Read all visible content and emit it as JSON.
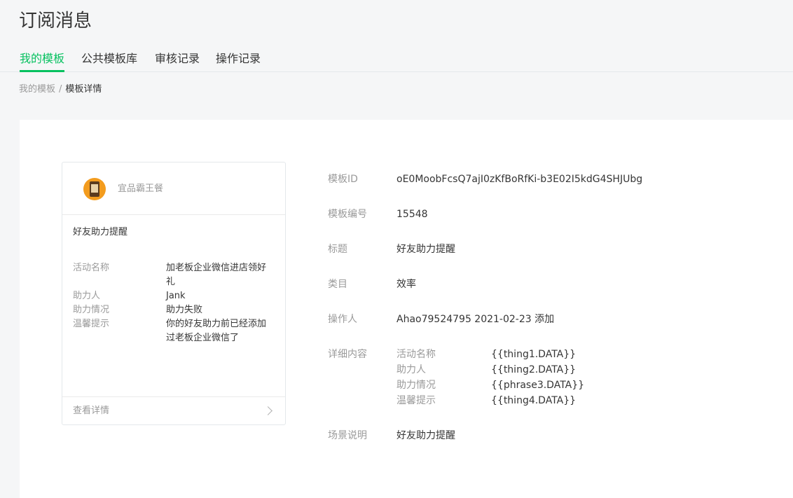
{
  "page_title": "订阅消息",
  "tabs": [
    {
      "label": "我的模板",
      "active": true
    },
    {
      "label": "公共模板库",
      "active": false
    },
    {
      "label": "审核记录",
      "active": false
    },
    {
      "label": "操作记录",
      "active": false
    }
  ],
  "breadcrumb": {
    "parent": "我的模板",
    "separator": "/",
    "current": "模板详情"
  },
  "preview": {
    "account_name": "宜品霸王餐",
    "title": "好友助力提醒",
    "fields": [
      {
        "key": "活动名称",
        "value": "加老板企业微信进店领好礼"
      },
      {
        "key": "助力人",
        "value": "Jank"
      },
      {
        "key": "助力情况",
        "value": "助力失败"
      },
      {
        "key": "温馨提示",
        "value": "你的好友助力前已经添加过老板企业微信了"
      }
    ],
    "footer_link": "查看详情"
  },
  "detail": {
    "template_id_label": "模板ID",
    "template_id": "oE0MoobFcsQ7ajI0zKfBoRfKi-b3E02I5kdG4SHJUbg",
    "template_number_label": "模板编号",
    "template_number": "15548",
    "title_label": "标题",
    "title": "好友助力提醒",
    "category_label": "类目",
    "category": "效率",
    "operator_label": "操作人",
    "operator": "Ahao79524795 2021-02-23 添加",
    "content_label": "详细内容",
    "content": [
      {
        "key": "活动名称",
        "value": "{{thing1.DATA}}"
      },
      {
        "key": "助力人",
        "value": "{{thing2.DATA}}"
      },
      {
        "key": "助力情况",
        "value": "{{phrase3.DATA}}"
      },
      {
        "key": "温馨提示",
        "value": "{{thing4.DATA}}"
      }
    ],
    "scene_label": "场景说明",
    "scene": "好友助力提醒"
  },
  "colors": {
    "accent": "#07c160",
    "background": "#f5f6f7",
    "label_gray": "#9a9a9a",
    "text": "#353535"
  }
}
